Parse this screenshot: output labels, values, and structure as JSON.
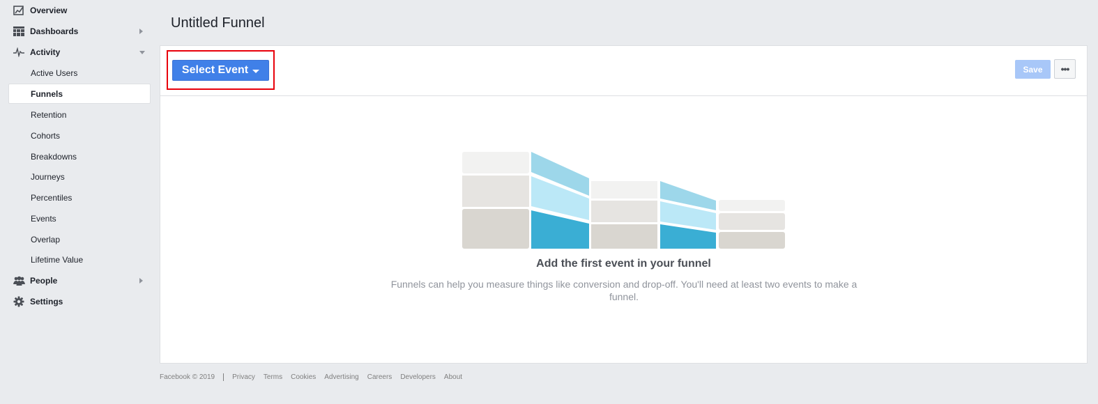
{
  "sidebar": {
    "top_items": [
      {
        "label": "Overview",
        "icon": "chart-line-icon"
      },
      {
        "label": "Dashboards",
        "icon": "grid-icon"
      },
      {
        "label": "Activity",
        "icon": "pulse-icon"
      },
      {
        "label": "People",
        "icon": "people-icon"
      },
      {
        "label": "Settings",
        "icon": "gear-icon"
      }
    ],
    "activity_items": [
      {
        "label": "Active Users"
      },
      {
        "label": "Funnels",
        "active": true
      },
      {
        "label": "Retention"
      },
      {
        "label": "Cohorts"
      },
      {
        "label": "Breakdowns"
      },
      {
        "label": "Journeys"
      },
      {
        "label": "Percentiles"
      },
      {
        "label": "Events"
      },
      {
        "label": "Overlap"
      },
      {
        "label": "Lifetime Value"
      }
    ]
  },
  "header": {
    "title": "Untitled Funnel"
  },
  "toolbar": {
    "select_event_label": "Select Event",
    "save_label": "Save",
    "more_label": "•••"
  },
  "empty_state": {
    "title": "Add the first event in your funnel",
    "description": "Funnels can help you measure things like conversion and drop-off. You'll need at least two events to make a funnel."
  },
  "colors": {
    "primary": "#4080e8",
    "save_disabled": "#a8c7f8",
    "highlight": "#e8000b",
    "funnel_blue_dark": "#3aaed4",
    "funnel_blue_mid": "#bbe8f7",
    "funnel_blue_light": "#9dd7ea"
  },
  "footer": {
    "copyright": "Facebook © 2019",
    "links": [
      "Privacy",
      "Terms",
      "Cookies",
      "Advertising",
      "Careers",
      "Developers",
      "About"
    ]
  }
}
